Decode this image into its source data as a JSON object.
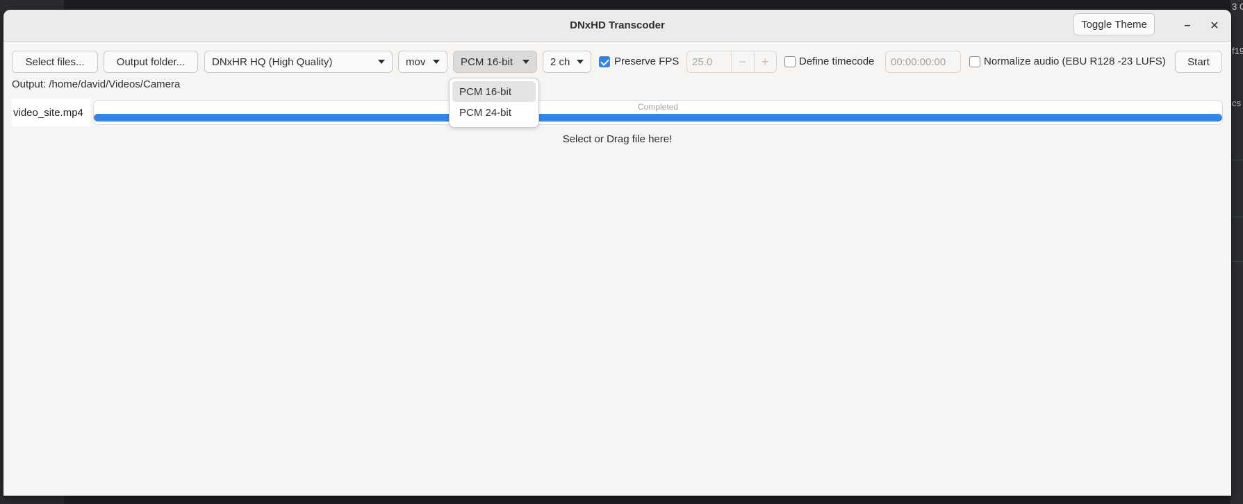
{
  "window": {
    "title": "DNxHD Transcoder",
    "toggle_theme_label": "Toggle Theme",
    "minimize_glyph": "–",
    "close_glyph": "✕"
  },
  "toolbar": {
    "select_files_label": "Select files...",
    "output_folder_label": "Output folder...",
    "codec_selected": "DNxHR HQ (High Quality)",
    "container_selected": "mov",
    "audio_selected": "PCM 16-bit",
    "channels_selected": "2 ch",
    "preserve_fps": {
      "label": "Preserve FPS",
      "checked": true
    },
    "fps_value": "25.0",
    "fps_decrement": "−",
    "fps_increment": "+",
    "define_timecode": {
      "label": "Define timecode",
      "checked": false
    },
    "timecode_value": "00:00:00:00",
    "normalize_audio": {
      "label": "Normalize audio (EBU R128 -23 LUFS)",
      "checked": false
    },
    "start_label": "Start"
  },
  "output": {
    "text": "Output: /home/david/Videos/Camera"
  },
  "files": [
    {
      "name": "video_site.mp4",
      "status": "Completed",
      "progress": 1.0
    }
  ],
  "drop_hint": "Select or Drag file here!",
  "audio_popover": {
    "options": [
      {
        "label": "PCM 16-bit",
        "selected": true
      },
      {
        "label": "PCM 24-bit",
        "selected": false
      }
    ]
  },
  "background_peek": {
    "text_1": "3 C",
    "text_2": "f19",
    "text_3": "cs"
  },
  "colors": {
    "accent": "#3584e4",
    "window_bg": "#f6f5f4",
    "titlebar_bg": "#ebebeb"
  }
}
